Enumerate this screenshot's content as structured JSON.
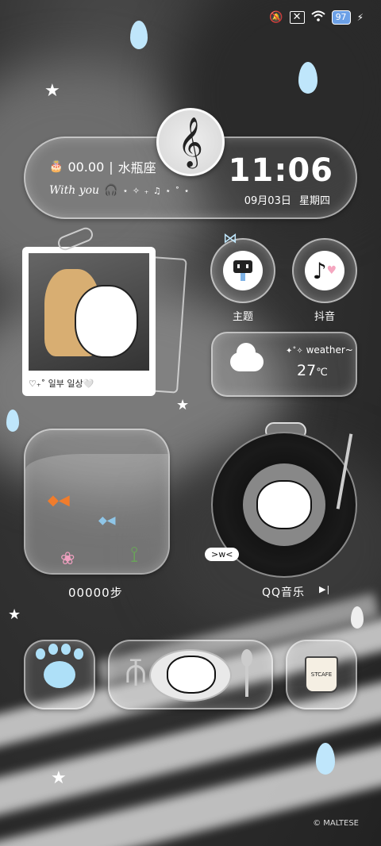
{
  "status_bar": {
    "battery": "97",
    "icons": [
      "mute-icon",
      "sim-off-icon",
      "wifi-icon",
      "battery-icon",
      "charging-icon"
    ]
  },
  "clock_widget": {
    "alarm": "00.00",
    "separator": "|",
    "zodiac": "水瓶座",
    "tagline": "With you",
    "decoration": "⋆ ✧ ₊ ♫ ⋆ ˚ ⋆",
    "time": "11:06",
    "date": "09月03日",
    "weekday": "星期四"
  },
  "photo_widget": {
    "caption": "♡₊˚ 일부 일상🤍"
  },
  "apps": {
    "theme": "主题",
    "douyin": "抖音"
  },
  "weather_widget": {
    "label": "weather~",
    "temperature": "27",
    "unit": "℃"
  },
  "aquarium_widget": {
    "steps": "00000步"
  },
  "music_widget": {
    "app": "QQ音乐",
    "bubble": ">w<",
    "play_icon": "▶|"
  },
  "bottom_row": {
    "cafe_cup_text": "STCAFE"
  },
  "watermark": "© MALTESE"
}
